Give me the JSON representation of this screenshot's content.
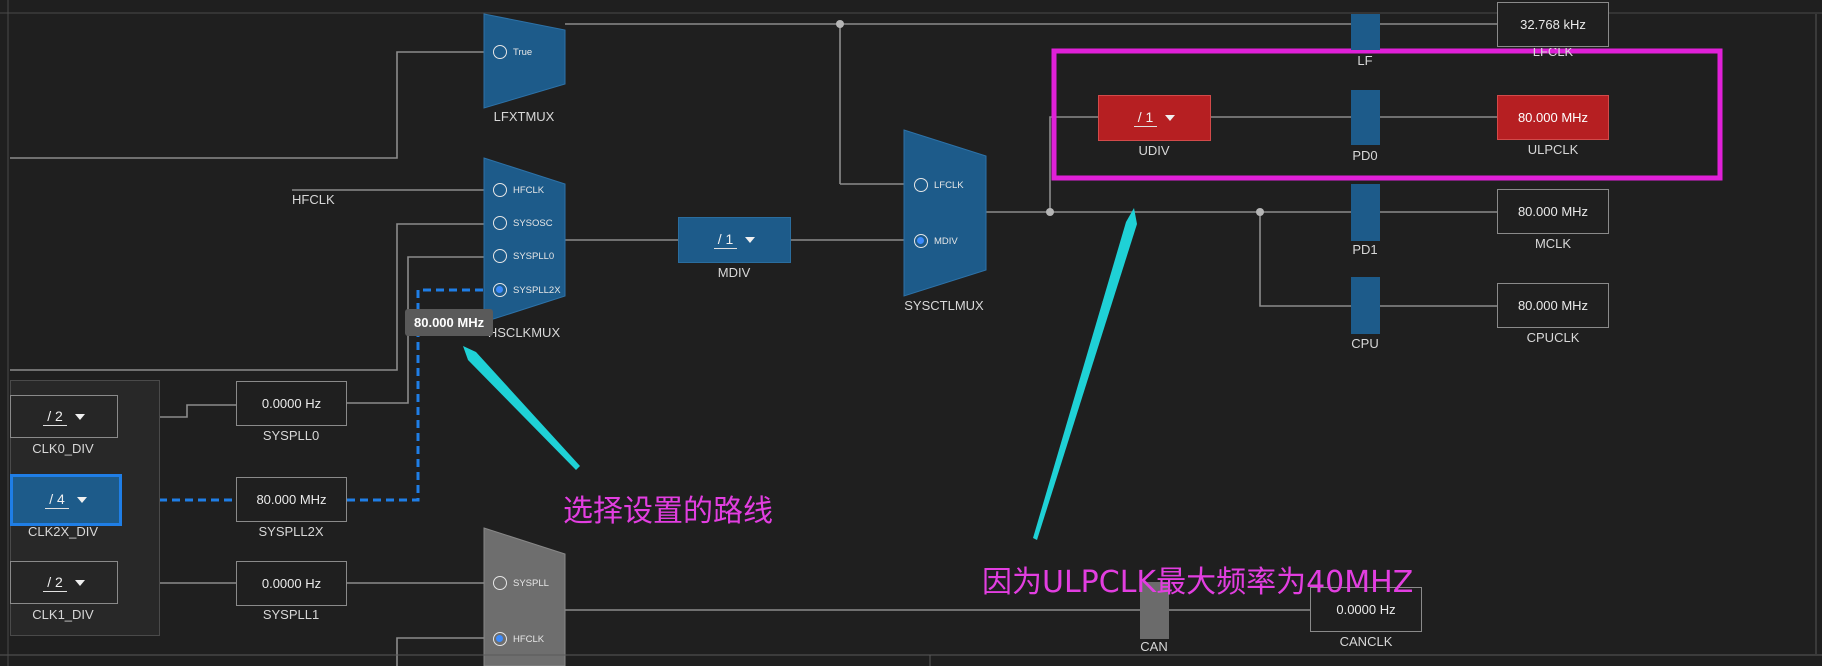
{
  "muxes": {
    "lfxtmux": {
      "label": "LFXTMUX",
      "options": [
        "True"
      ],
      "selected": ""
    },
    "hsclkmux": {
      "label": "HSCLKMUX",
      "options": [
        "HFCLK",
        "SYSOSC",
        "SYSPLL0",
        "SYSPLL2X"
      ],
      "selected": "SYSPLL2X"
    },
    "sysctlmux": {
      "label": "SYSCTLMUX",
      "options": [
        "LFCLK",
        "MDIV"
      ],
      "selected": "MDIV"
    },
    "canmux": {
      "options": [
        "SYSPLL",
        "HFCLK"
      ],
      "selected": "HFCLK"
    }
  },
  "inputs": {
    "hfclk": "HFCLK"
  },
  "dividers": {
    "mdiv": {
      "value": "/ 1",
      "label": "MDIV"
    },
    "udiv": {
      "value": "/ 1",
      "label": "UDIV"
    },
    "clk0_div": {
      "value": "/ 2",
      "label": "CLK0_DIV"
    },
    "clk2x_div": {
      "value": "/ 4",
      "label": "CLK2X_DIV"
    },
    "clk1_div": {
      "value": "/ 2",
      "label": "CLK1_DIV"
    }
  },
  "pll_outputs": {
    "syspll0": {
      "value": "0.0000 Hz",
      "label": "SYSPLL0"
    },
    "syspll2x": {
      "value": "80.000 MHz",
      "label": "SYSPLL2X"
    },
    "syspll1": {
      "value": "0.0000 Hz",
      "label": "SYSPLL1"
    }
  },
  "gates": {
    "lf": "LF",
    "pd0": "PD0",
    "pd1": "PD1",
    "cpu": "CPU",
    "can": "CAN"
  },
  "clocks": {
    "lfclk": {
      "value": "32.768 kHz",
      "label": "LFCLK"
    },
    "ulpclk": {
      "value": "80.000 MHz",
      "label": "ULPCLK"
    },
    "mclk": {
      "value": "80.000 MHz",
      "label": "MCLK"
    },
    "cpuclk": {
      "value": "80.000 MHz",
      "label": "CPUCLK"
    },
    "canclk": {
      "value": "0.0000 Hz",
      "label": "CANCLK"
    }
  },
  "tooltip": "80.000 MHz",
  "annotations": {
    "route": "选择设置的路线",
    "reason": "因为ULPCLK最大频率为40MHZ"
  },
  "colors": {
    "background": "#1f1f1f",
    "mux_blue": "#1d5b8a",
    "error_red": "#b61f22",
    "highlight_magenta": "#e020d8",
    "selection_blue": "#1f7ee6",
    "arrow_cyan": "#1fd1d6"
  }
}
